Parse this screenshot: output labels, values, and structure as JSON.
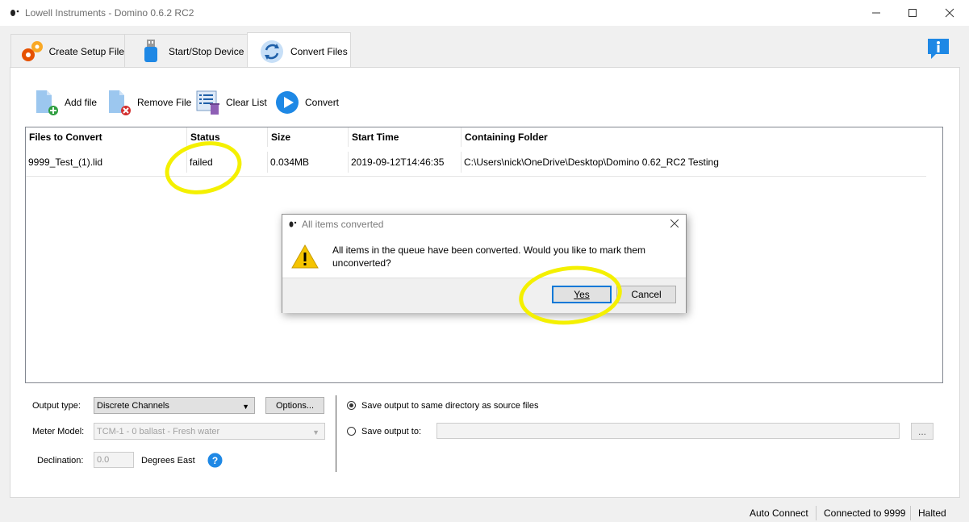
{
  "window": {
    "title": "Lowell Instruments - Domino 0.6.2 RC2"
  },
  "tabs": [
    {
      "label": "Create Setup File",
      "icon": "gears-icon"
    },
    {
      "label": "Start/Stop Device",
      "icon": "usb-icon"
    },
    {
      "label": "Convert Files",
      "icon": "refresh-icon",
      "active": true
    }
  ],
  "toolbar": {
    "add_file": "Add file",
    "remove_file": "Remove File",
    "clear_list": "Clear List",
    "convert": "Convert"
  },
  "table": {
    "columns": [
      "Files to Convert",
      "Status",
      "Size",
      "Start Time",
      "Containing Folder"
    ],
    "rows": [
      [
        "9999_Test_(1).lid",
        "failed",
        "0.034MB",
        "2019-09-12T14:46:35",
        "C:\\Users\\nick\\OneDrive\\Desktop\\Domino 0.62_RC2 Testing"
      ]
    ]
  },
  "dialog": {
    "title": "All items converted",
    "message": "All items in the queue have been converted. Would you like to mark them unconverted?",
    "yes": "Yes",
    "cancel": "Cancel"
  },
  "options": {
    "output_type_label": "Output type:",
    "output_type_value": "Discrete Channels",
    "options_button": "Options...",
    "meter_model_label": "Meter Model:",
    "meter_model_value": "TCM-1 - 0 ballast - Fresh water",
    "declination_label": "Declination:",
    "declination_value": "0.0",
    "declination_unit": "Degrees East",
    "save_same_dir": "Save output to same directory as source files",
    "save_to": "Save output to:",
    "browse": "..."
  },
  "statusbar": {
    "auto_connect": "Auto Connect",
    "connection": "Connected to 9999",
    "state": "Halted"
  },
  "colors": {
    "accent_blue": "#1e88e5",
    "highlight": "#f4f000",
    "warning": "#f5c400"
  }
}
